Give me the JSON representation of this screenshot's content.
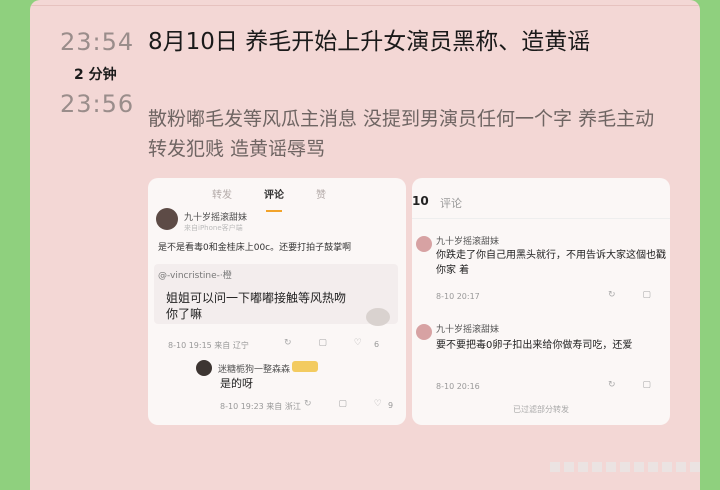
{
  "timeline": {
    "time_1": "23:54",
    "duration": "2 分钟",
    "time_2": "23:56"
  },
  "post": {
    "title": "8月10日 养毛开始上升女演员黑称、造黄谣",
    "description": "散粉嘟毛发等风瓜主消息 没提到男演员任何一个字 养毛主动转发犯贱 造黄谣辱骂"
  },
  "screenshot_left": {
    "tabs": [
      "转发",
      "评论",
      "赞"
    ],
    "active_tab": "评论",
    "author": "九十岁摇滚甜妹",
    "author_sub": "来自iPhone客户端",
    "body": "是不是看毒0和金桂床上00c。还要打拍子鼓掌啊",
    "quote_name": "@-vincristine-·橙",
    "quote_text": "姐姐可以问一下嘟嘟接触等风热吻你了嘛",
    "quote_meta": "8-10 19:15 来自 辽宁",
    "quote_like": "6",
    "reply_name": "迷糖栀狗一整森森",
    "reply_text": "是的呀",
    "reply_meta": "8-10 19:23 来自 浙江",
    "reply_like": "9"
  },
  "screenshot_right": {
    "header_count": "10",
    "header_label": "评论",
    "comment1_name": "九十岁摇滚甜妹",
    "comment1_text": "你跌走了你自己用黑头就行，不用告诉大家这個也戳你家 着",
    "comment1_meta": "8-10 20:17",
    "comment2_name": "九十岁摇滚甜妹",
    "comment2_text": "要不要把毒0卵子扣出来给你做寿司吃，还爱",
    "comment2_meta": "8-10 20:16",
    "fold_text": "已过滤部分转发"
  }
}
